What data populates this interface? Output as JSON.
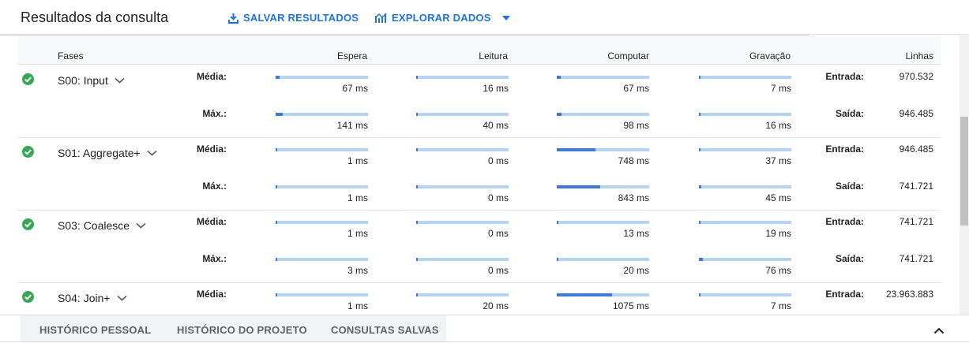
{
  "header": {
    "title": "Resultados da consulta",
    "save_label": "SALVAR RESULTADOS",
    "explore_label": "EXPLORAR DADOS",
    "accent": "#1a73e8"
  },
  "table": {
    "columns": {
      "fases": "Fases",
      "espera": "Espera",
      "leitura": "Leitura",
      "computar": "Computar",
      "gravacao": "Gravação",
      "linhas": "Linhas"
    },
    "row_labels": {
      "avg": "Média:",
      "max": "Máx.:"
    },
    "io_labels": {
      "in": "Entrada:",
      "out": "Saída:"
    },
    "bar_colors": {
      "track": "#b3d4f5",
      "fill": "#3b78e7"
    },
    "status_color": "#34a853",
    "stages": [
      {
        "name": "S00: Input",
        "avg": [
          {
            "label": "67 ms",
            "fraction": 0.04
          },
          {
            "label": "16 ms",
            "fraction": 0.01
          },
          {
            "label": "67 ms",
            "fraction": 0.04
          },
          {
            "label": "7 ms",
            "fraction": 0.005
          }
        ],
        "max": [
          {
            "label": "141 ms",
            "fraction": 0.08
          },
          {
            "label": "40 ms",
            "fraction": 0.02
          },
          {
            "label": "98 ms",
            "fraction": 0.055
          },
          {
            "label": "16 ms",
            "fraction": 0.01
          }
        ],
        "in": "970.532",
        "out": "946.485"
      },
      {
        "name": "S01: Aggregate+",
        "avg": [
          {
            "label": "1 ms",
            "fraction": 0
          },
          {
            "label": "0 ms",
            "fraction": 0
          },
          {
            "label": "748 ms",
            "fraction": 0.42
          },
          {
            "label": "37 ms",
            "fraction": 0.02
          }
        ],
        "max": [
          {
            "label": "1 ms",
            "fraction": 0
          },
          {
            "label": "0 ms",
            "fraction": 0
          },
          {
            "label": "843 ms",
            "fraction": 0.47
          },
          {
            "label": "45 ms",
            "fraction": 0.025
          }
        ],
        "in": "946.485",
        "out": "741.721"
      },
      {
        "name": "S03: Coalesce",
        "avg": [
          {
            "label": "1 ms",
            "fraction": 0
          },
          {
            "label": "0 ms",
            "fraction": 0
          },
          {
            "label": "13 ms",
            "fraction": 0.007
          },
          {
            "label": "19 ms",
            "fraction": 0.011
          }
        ],
        "max": [
          {
            "label": "3 ms",
            "fraction": 0.002
          },
          {
            "label": "0 ms",
            "fraction": 0
          },
          {
            "label": "20 ms",
            "fraction": 0.011
          },
          {
            "label": "76 ms",
            "fraction": 0.042
          }
        ],
        "in": "741.721",
        "out": "741.721"
      },
      {
        "name": "S04: Join+",
        "avg": [
          {
            "label": "1 ms",
            "fraction": 0
          },
          {
            "label": "20 ms",
            "fraction": 0.011
          },
          {
            "label": "1075 ms",
            "fraction": 0.6
          },
          {
            "label": "7 ms",
            "fraction": 0.004
          }
        ],
        "max": [],
        "in": "23.963.883",
        "out": ""
      }
    ]
  },
  "bottom": {
    "tabs": [
      "HISTÓRICO PESSOAL",
      "HISTÓRICO DO PROJETO",
      "CONSULTAS SALVAS"
    ]
  }
}
